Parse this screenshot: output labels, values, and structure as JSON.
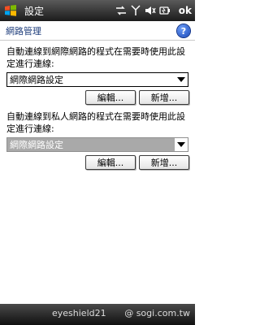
{
  "titlebar": {
    "title": "設定",
    "ok_label": "ok",
    "start_icon": "windows-flag-icon",
    "tray_icons": [
      "sync-icon",
      "signal-icon",
      "volume-icon",
      "battery-icon"
    ]
  },
  "page": {
    "title": "網路管理",
    "help_label": "?"
  },
  "section1": {
    "label": "自動連線到網際網路的程式在需要時使用此設定進行連線:",
    "selected": "網際網路設定",
    "edit_label": "編輯...",
    "new_label": "新增..."
  },
  "section2": {
    "label": "自動連線到私人網路的程式在需要時使用此設定進行連線:",
    "selected": "網際網路設定",
    "edit_label": "編輯...",
    "new_label": "新增..."
  },
  "bottombar": {
    "watermark_left": "eyeshield21",
    "watermark_right": "@ sogi.com.tw"
  },
  "colors": {
    "title_bar": "#2b2b2b",
    "header_text": "#1e3d7b",
    "selected_disabled_bg": "#a9a9a9"
  }
}
